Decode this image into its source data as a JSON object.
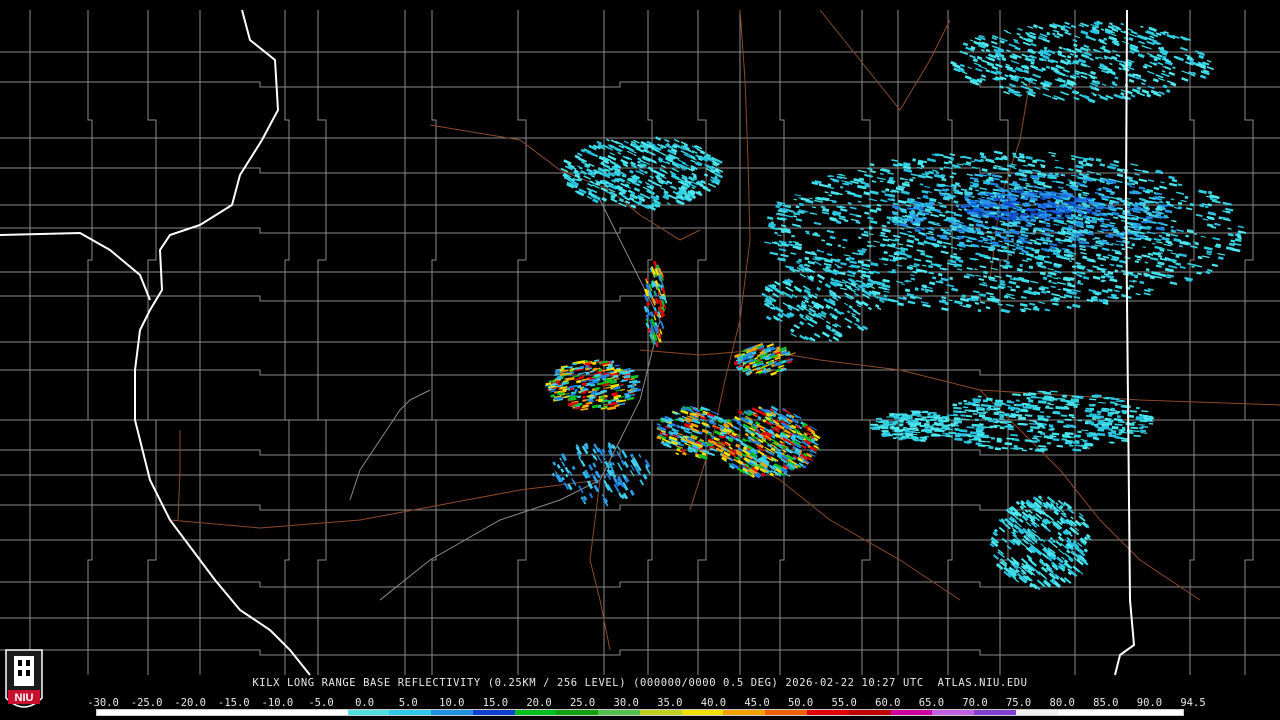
{
  "caption": "KILX LONG RANGE BASE REFLECTIVITY (0.25KM / 256 LEVEL) (000000/0000 0.5 DEG) 2026-02-22 10:27 UTC  ATLAS.NIU.EDU",
  "logo": {
    "text": "NIU",
    "accent": "#c8102e"
  },
  "scale": {
    "labels": [
      "-30.0",
      "-25.0",
      "-20.0",
      "-15.0",
      "-10.0",
      "-5.0",
      "0.0",
      "5.0",
      "10.0",
      "15.0",
      "20.0",
      "25.0",
      "30.0",
      "35.0",
      "40.0",
      "45.0",
      "50.0",
      "55.0",
      "60.0",
      "65.0",
      "70.0",
      "75.0",
      "80.0",
      "85.0",
      "90.0",
      "94.5"
    ],
    "colors": [
      "#ffffff",
      "#ffffff",
      "#ffffff",
      "#ffffff",
      "#ffffff",
      "#ffffff",
      "#50e0e0",
      "#30c8e8",
      "#2090e0",
      "#1040d0",
      "#00c020",
      "#10a010",
      "#50c050",
      "#c0d020",
      "#f0e000",
      "#f0a000",
      "#f06000",
      "#e00000",
      "#c00000",
      "#d000a0",
      "#c060e0",
      "#8040d0",
      "#f0f0f0",
      "#ffffff",
      "#ffffff",
      "#ffffff"
    ]
  },
  "map_colors": {
    "background": "#000000",
    "county_lines": "#8a8a8a",
    "state_lines": "#ffffff",
    "roads": "#8b4a2a",
    "echo_light": "#30d0e0",
    "echo_mid": "#2aa0e8",
    "echo_strong": "#1050d0"
  }
}
